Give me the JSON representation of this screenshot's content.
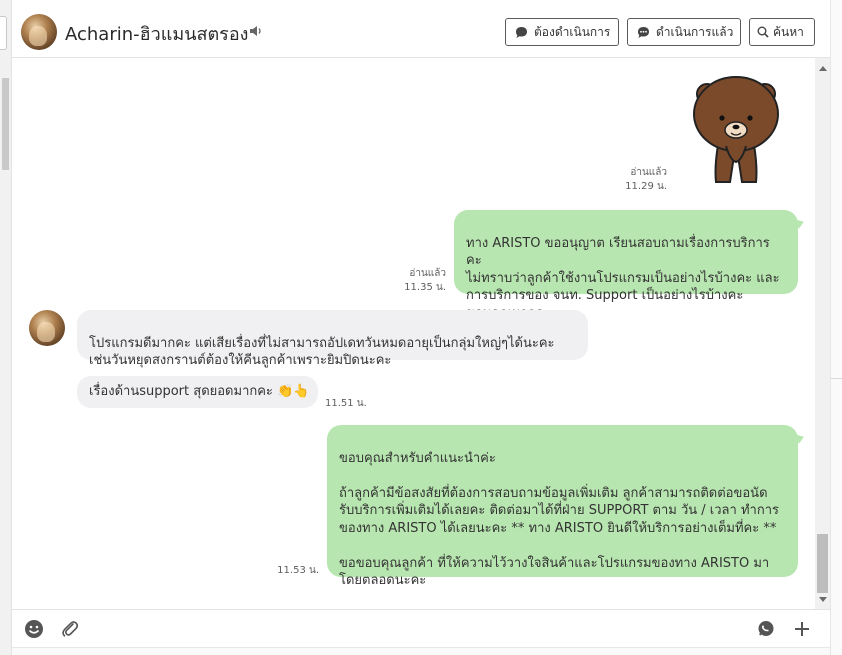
{
  "header": {
    "contact_name": "Acharin-ฮิวแมนสตรอง",
    "buttons": {
      "todo": "ต้องดำเนินการ",
      "done": "ดำเนินการแล้ว",
      "search": "ค้นหา"
    }
  },
  "messages": [
    {
      "type": "sticker",
      "direction": "out",
      "sticker_name": "brown-bear-sticker",
      "read_label": "อ่านแล้ว",
      "time": "11.29 น."
    },
    {
      "type": "text",
      "direction": "out",
      "text": "ทาง ARISTO ขออนุญาต เรียนสอบถามเรื่องการบริการ คะ\nไม่ทราบว่าลูกค้าใช้งานโปรแกรมเป็นอย่างไรบ้างคะ และ\nการบริการของ จนท. Support เป็นอย่างไรบ้างคะ\nขอบคุณมากคะ",
      "read_label": "อ่านแล้ว",
      "time": "11.35 น."
    },
    {
      "type": "text",
      "direction": "in",
      "text": "โปรแกรมดีมากคะ แต่เสียเรื่องที่ไม่สามารถอัปเดทวันหมดอายุเป็นกลุ่มใหญ่ๆได้นะคะ\nเช่นวันหยุดสงกรานต์ต้องให้คีนลูกค้าเพราะยิมปิดนะคะ"
    },
    {
      "type": "text",
      "direction": "in",
      "text": "เรื่องด้านsupport สุดยอดมากคะ 👏👆",
      "time": "11.51 น."
    },
    {
      "type": "text",
      "direction": "out",
      "text": "ขอบคุณสำหรับคำแนะนำค่ะ\n\nถ้าลูกค้ามีข้อสงสัยที่ต้องการสอบถามข้อมูลเพิ่มเติม ลูกค้าสามารถติดต่อขอนัด\nรับบริการเพิ่มเติมได้เลยคะ ติดต่อมาได้ที่ฝ่าย SUPPORT ตาม วัน / เวลา ทำการ\nของทาง ARISTO ได้เลยนะคะ ** ทาง ARISTO ยินดีให้บริการอย่างเต็มที่คะ **\n\nขอขอบคุณลูกค้า ที่ให้ความไว้วางใจสินค้าและโปรแกรมของทาง ARISTO มา\nโดยตลอดนะคะ",
      "time": "11.53 น."
    }
  ],
  "colors": {
    "outgoing_bubble": "#b8e6b0",
    "incoming_bubble": "#f0f0f2",
    "icon_gray": "#555555"
  },
  "icons": [
    "speaker-icon",
    "chat-bubble-icon",
    "search-icon",
    "emoji-icon",
    "paperclip-icon",
    "chat-template-icon",
    "plus-icon"
  ]
}
